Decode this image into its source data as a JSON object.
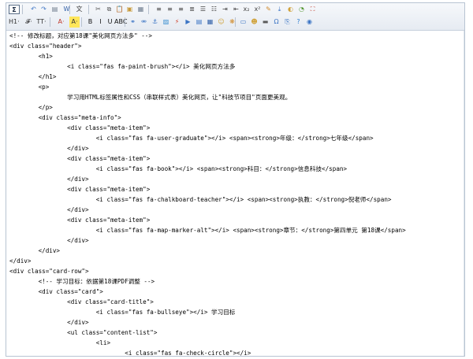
{
  "toolbar": {
    "row1": [
      {
        "name": "source-button",
        "glyph": "Σ"
      },
      {
        "name": "undo-icon",
        "glyph": "↶",
        "color": "#3b74c4"
      },
      {
        "name": "redo-icon",
        "glyph": "↷",
        "color": "#3b74c4"
      },
      {
        "name": "paste-text-icon",
        "glyph": "▤",
        "color": "#6c7a8c"
      },
      {
        "name": "paste-word-icon",
        "glyph": "W",
        "color": "#2f5fa8"
      },
      {
        "name": "paste-format-icon",
        "glyph": "文",
        "color": "#3a3a3a"
      },
      {
        "name": "cut-icon",
        "glyph": "✂",
        "color": "#5a5a5a"
      },
      {
        "name": "copy-icon",
        "glyph": "⧉",
        "color": "#5a5a5a"
      },
      {
        "name": "paste-icon",
        "glyph": "📋",
        "color": "#c79a3a"
      },
      {
        "name": "paste-special-icon",
        "glyph": "▣",
        "color": "#c79a3a"
      },
      {
        "name": "find-replace-icon",
        "glyph": "▦",
        "color": "#6c7a8c"
      },
      {
        "name": "align-left-icon",
        "glyph": "≡",
        "color": "#444"
      },
      {
        "name": "align-center-icon",
        "glyph": "≡",
        "color": "#444"
      },
      {
        "name": "align-right-icon",
        "glyph": "≡",
        "color": "#444"
      },
      {
        "name": "align-justify-icon",
        "glyph": "≣",
        "color": "#444"
      },
      {
        "name": "ordered-list-icon",
        "glyph": "☰",
        "color": "#444"
      },
      {
        "name": "unordered-list-icon",
        "glyph": "☷",
        "color": "#444"
      },
      {
        "name": "indent-icon",
        "glyph": "⇥",
        "color": "#444"
      },
      {
        "name": "outdent-icon",
        "glyph": "⇤",
        "color": "#444"
      },
      {
        "name": "subscript-icon",
        "glyph": "x₂",
        "color": "#444"
      },
      {
        "name": "superscript-icon",
        "glyph": "x²",
        "color": "#444"
      },
      {
        "name": "clear-format-icon",
        "glyph": "✎",
        "color": "#d08a2a"
      },
      {
        "name": "select-all-icon",
        "glyph": "⤓",
        "color": "#3b74c4"
      },
      {
        "name": "print-icon",
        "glyph": "◐",
        "color": "#d0a23a"
      },
      {
        "name": "preview-icon",
        "glyph": "◔",
        "color": "#5a9a3a"
      },
      {
        "name": "fullscreen-icon",
        "glyph": "⛶",
        "color": "#c0392b"
      }
    ],
    "row2": [
      {
        "name": "heading-icon",
        "glyph": "H1·",
        "color": "#333"
      },
      {
        "name": "font-family-icon",
        "glyph": "𝓕·",
        "color": "#333"
      },
      {
        "name": "font-size-icon",
        "glyph": "TT·",
        "color": "#333"
      },
      {
        "name": "text-color-icon",
        "glyph": "A·",
        "color": "#c0392b"
      },
      {
        "name": "background-color-icon",
        "glyph": "A·",
        "color": "#333",
        "bg": "#ffe65a"
      },
      {
        "name": "bold-icon",
        "glyph": "B",
        "color": "#111"
      },
      {
        "name": "italic-icon",
        "glyph": "I",
        "color": "#111"
      },
      {
        "name": "underline-icon",
        "glyph": "U",
        "color": "#111"
      },
      {
        "name": "strikethrough-icon",
        "glyph": "ABC",
        "color": "#111"
      },
      {
        "name": "link-icon",
        "glyph": "⚭",
        "color": "#3b74c4"
      },
      {
        "name": "unlink-icon",
        "glyph": "⚮",
        "color": "#3b74c4"
      },
      {
        "name": "anchor-icon",
        "glyph": "⚓",
        "color": "#3b74c4"
      },
      {
        "name": "image-icon",
        "glyph": "▨",
        "color": "#3b8fd0"
      },
      {
        "name": "flash-icon",
        "glyph": "⚡",
        "color": "#d0402a"
      },
      {
        "name": "media-icon",
        "glyph": "▶",
        "color": "#3b74c4"
      },
      {
        "name": "file-icon",
        "glyph": "▤",
        "color": "#3b74c4"
      },
      {
        "name": "table-icon",
        "glyph": "▦",
        "color": "#2f5fa8"
      },
      {
        "name": "emoticon-icon",
        "glyph": "☺",
        "color": "#d0a23a"
      },
      {
        "name": "template-icon",
        "glyph": "❋",
        "color": "#d08a2a"
      },
      {
        "name": "code-icon",
        "glyph": "▭",
        "color": "#3b74c4"
      },
      {
        "name": "map-icon",
        "glyph": "☻",
        "color": "#d0a23a"
      },
      {
        "name": "horizontal-rule-icon",
        "glyph": "▬",
        "color": "#5a5a5a"
      },
      {
        "name": "special-char-icon",
        "glyph": "Ω",
        "color": "#3b74c4"
      },
      {
        "name": "page-break-icon",
        "glyph": "⎘",
        "color": "#3b74c4"
      },
      {
        "name": "help-icon",
        "glyph": "?",
        "color": "#2f7fd0"
      },
      {
        "name": "about-icon",
        "glyph": "◉",
        "color": "#3b74c4"
      }
    ]
  },
  "code_lines": [
    "<!-- 修改标题，对应第18课\"美化网页方法多\" -->",
    "<div class=\"header\">",
    "        <h1>",
    "                <i class=\"fas fa-paint-brush\"></i> 美化网页方法多",
    "        </h1>",
    "        <p>",
    "                学习用HTML标签属性和CSS（串联样式表）美化网页，让\"科技节项目\"页面更美观。",
    "        </p>",
    "        <div class=\"meta-info\">",
    "                <div class=\"meta-item\">",
    "                        <i class=\"fas fa-user-graduate\"></i> <span><strong>年级：</strong>七年级</span>",
    "                </div>",
    "                <div class=\"meta-item\">",
    "                        <i class=\"fas fa-book\"></i> <span><strong>科目：</strong>信息科技</span>",
    "                </div>",
    "                <div class=\"meta-item\">",
    "                        <i class=\"fas fa-chalkboard-teacher\"></i> <span><strong>执教：</strong>倪老师</span>",
    "                </div>",
    "                <div class=\"meta-item\">",
    "                        <i class=\"fas fa-map-marker-alt\"></i> <span><strong>章节：</strong>第四单元 第18课</span>",
    "                </div>",
    "        </div>",
    "</div>",
    "<div class=\"card-row\">",
    "        <!-- 学习目标：依据第18课PDF调整 -->",
    "        <div class=\"card\">",
    "                <div class=\"card-title\">",
    "                        <i class=\"fas fa-bullseye\"></i> 学习目标",
    "                </div>",
    "                <ul class=\"content-list\">",
    "                        <li>",
    "                                <i class=\"fas fa-check-circle\"></i>"
  ]
}
